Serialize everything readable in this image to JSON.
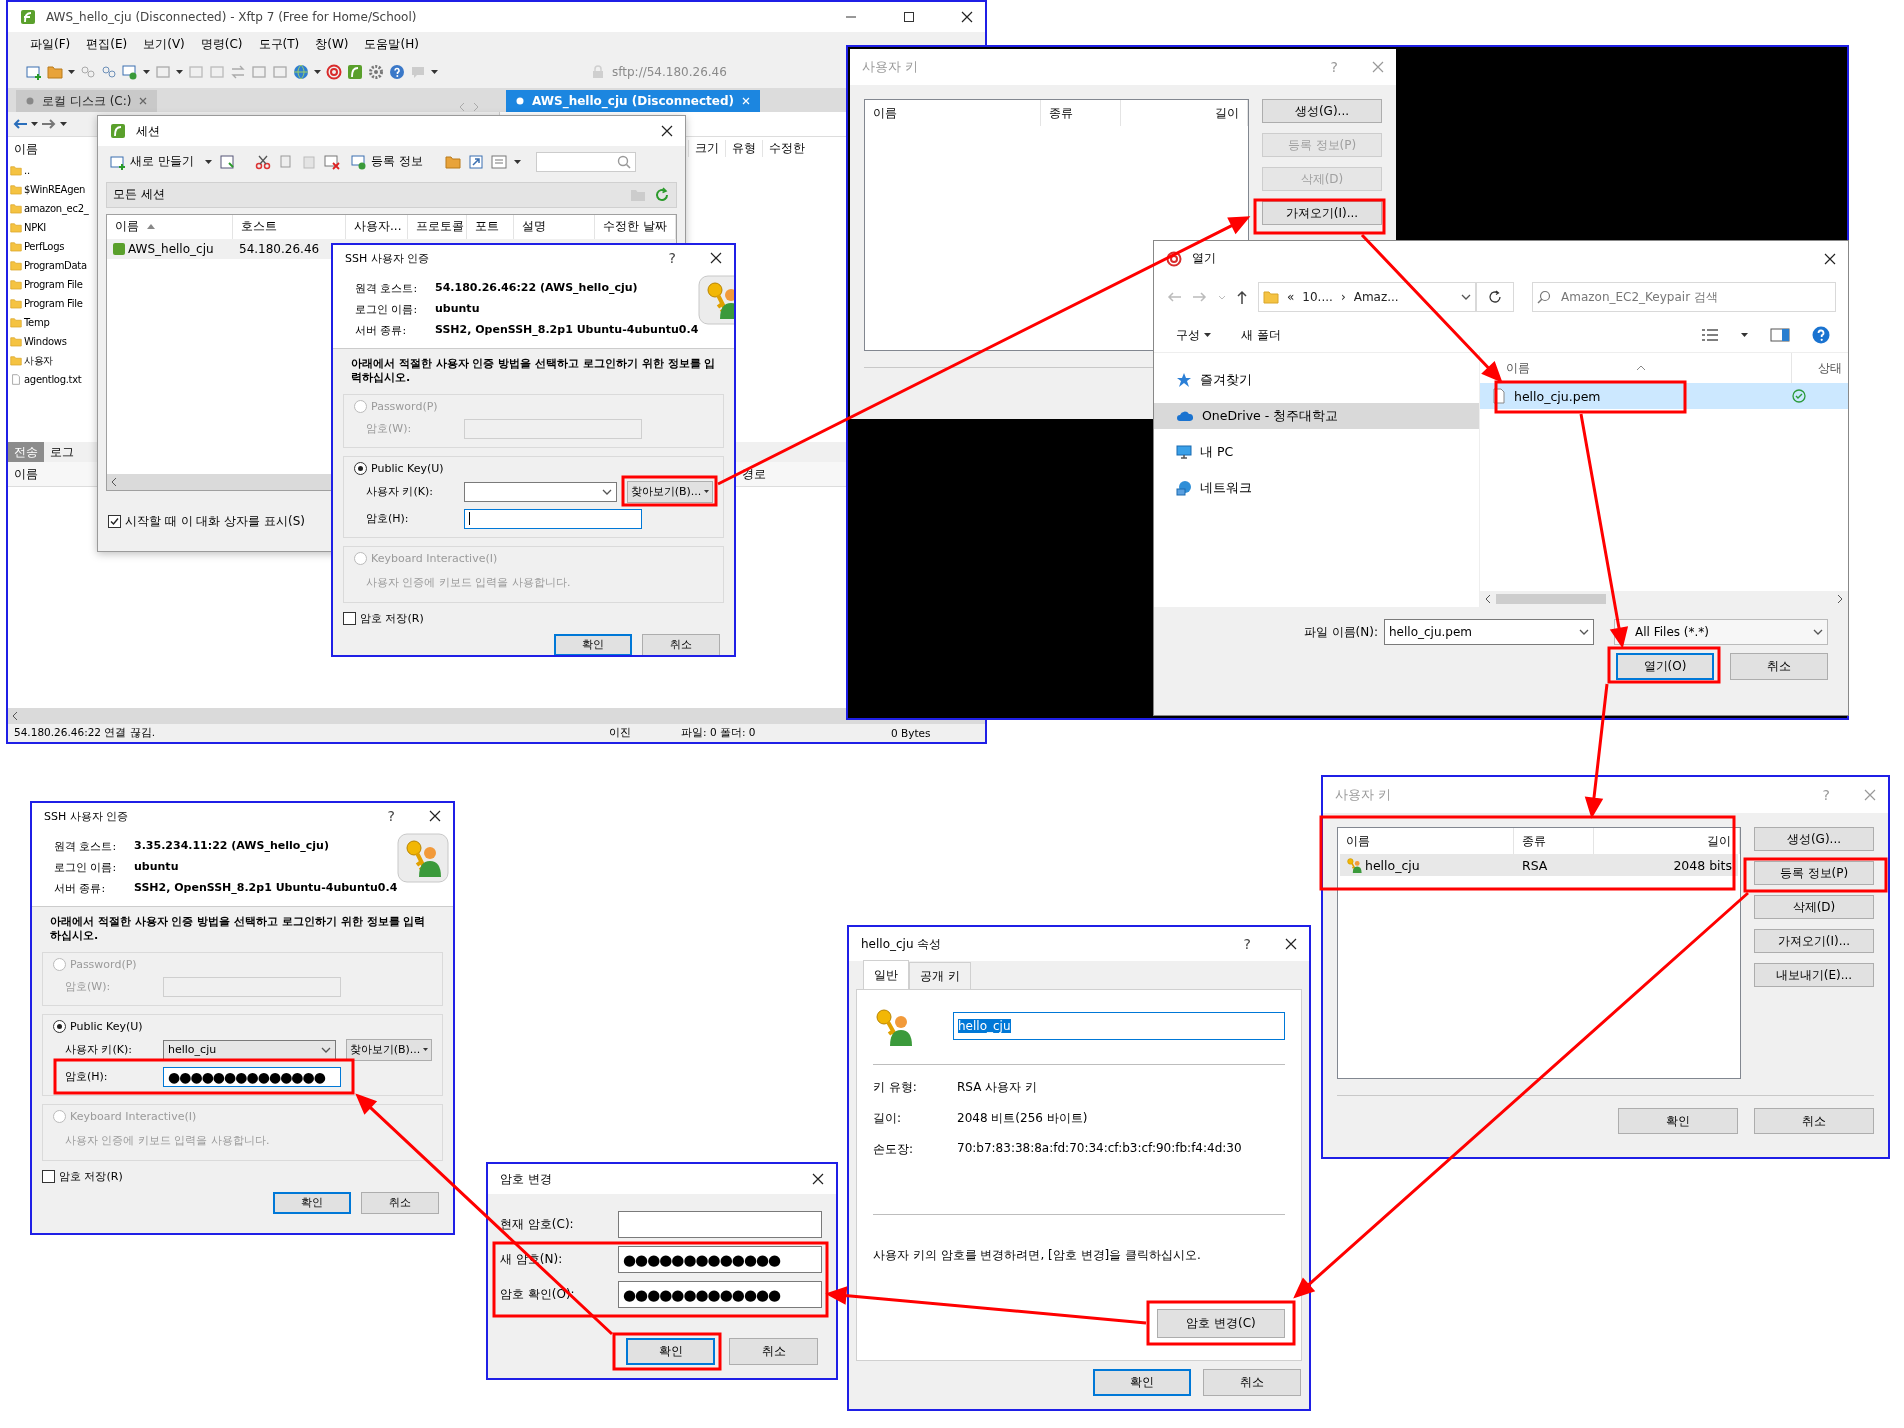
{
  "xftp_window": {
    "title": "AWS_hello_cju (Disconnected) - Xftp 7 (Free for Home/School)",
    "menu": [
      "파일(F)",
      "편집(E)",
      "보기(V)",
      "명령(C)",
      "도구(T)",
      "창(W)",
      "도움말(H)"
    ],
    "address": "sftp://54.180.26.46",
    "tabs": [
      {
        "label": "로컬 디스크 (C:)",
        "selected": false
      },
      {
        "label": "AWS_hello_cju (Disconnected)",
        "selected": true
      }
    ],
    "local_pane": {
      "column": "이름",
      "files": [
        {
          "name": "..",
          "kind": "folder"
        },
        {
          "name": "$WinREAgen",
          "kind": "folder"
        },
        {
          "name": "amazon_ec2_",
          "kind": "folder"
        },
        {
          "name": "NPKI",
          "kind": "folder"
        },
        {
          "name": "PerfLogs",
          "kind": "folder"
        },
        {
          "name": "ProgramData",
          "kind": "folder"
        },
        {
          "name": "Program File",
          "kind": "folder"
        },
        {
          "name": "Program File",
          "kind": "folder"
        },
        {
          "name": "Temp",
          "kind": "folder"
        },
        {
          "name": "Windows",
          "kind": "folder"
        },
        {
          "name": "사용자",
          "kind": "folder"
        },
        {
          "name": "agentlog.txt",
          "kind": "file"
        }
      ]
    },
    "remote_pane": {
      "columns": [
        "크기",
        "유형",
        "수정한"
      ]
    },
    "bottom_tabs": [
      {
        "label": "전송",
        "selected": true
      },
      {
        "label": "로그",
        "selected": false
      }
    ],
    "bottom_columns": [
      "이름",
      "경로"
    ],
    "status_bar": {
      "connection": "54.180.26.46:22 연결 끊김.",
      "mode": "이진",
      "counts": "파일: 0 폴더: 0",
      "size": "0 Bytes"
    }
  },
  "session_dialog": {
    "title": "세션",
    "new_button": "새로 만들기",
    "properties_button": "등록 정보",
    "path": "모든 세션",
    "columns": [
      "이름",
      "호스트",
      "사용자...",
      "프로토콜",
      "포트",
      "설명",
      "수정한 날짜"
    ],
    "rows": [
      {
        "cells": [
          "AWS_hello_cju",
          "54.180.26.46"
        ]
      }
    ],
    "show_on_startup": {
      "label": "시작할 때 이 대화 상자를 표시(S)",
      "checked": true
    }
  },
  "ssh_auth_dialogs": [
    {
      "title": "SSH 사용자 인증",
      "help": "?",
      "info": [
        {
          "label": "원격 호스트:",
          "value": "54.180.26.46:22 (AWS_hello_cju)"
        },
        {
          "label": "로그인 이름:",
          "value": "ubuntu"
        },
        {
          "label": "서버 종류:",
          "value": "SSH2, OpenSSH_8.2p1 Ubuntu-4ubuntu0.4"
        }
      ],
      "instruction": "아래에서 적절한 사용자 인증 방법을 선택하고 로그인하기 위한 정보를 입력하십시오.",
      "methods": [
        {
          "kind": "password",
          "label": "Password(P)",
          "selected": false,
          "field_label": "암호(W):"
        },
        {
          "kind": "public_key",
          "label": "Public Key(U)",
          "selected": true,
          "key_label": "사용자 키(K):",
          "browse_button": "찾아보기(B)...",
          "password_label": "암호(H):"
        },
        {
          "kind": "keyboard",
          "label": "Keyboard Interactive(I)",
          "selected": false,
          "hint": "사용자 인증에 키보드 입력을 사용합니다."
        }
      ],
      "save_password": {
        "label": "암호 저장(R)",
        "checked": false
      },
      "buttons": [
        "확인",
        "취소"
      ]
    },
    {
      "title": "SSH 사용자 인증",
      "help": "?",
      "info": [
        {
          "label": "원격 호스트:",
          "value": "3.35.234.11:22 (AWS_hello_cju)"
        },
        {
          "label": "로그인 이름:",
          "value": "ubuntu"
        },
        {
          "label": "서버 종류:",
          "value": "SSH2, OpenSSH_8.2p1 Ubuntu-4ubuntu0.4"
        }
      ],
      "instruction": "아래에서 적절한 사용자 인증 방법을 선택하고 로그인하기 위한 정보를 입력하십시오.",
      "methods": [
        {
          "kind": "password",
          "label": "Password(P)",
          "selected": false,
          "field_label": "암호(W):"
        },
        {
          "kind": "public_key",
          "label": "Public Key(U)",
          "selected": true,
          "key_label": "사용자 키(K):",
          "key_value": "hello_cju",
          "browse_button": "찾아보기(B)...",
          "password_label": "암호(H):",
          "password_value": "●●●●●●●●●●●●●●"
        },
        {
          "kind": "keyboard",
          "label": "Keyboard Interactive(I)",
          "selected": false,
          "hint": "사용자 인증에 키보드 입력을 사용합니다."
        }
      ],
      "save_password": {
        "label": "암호 저장(R)",
        "checked": false
      },
      "buttons": [
        "확인",
        "취소"
      ]
    }
  ],
  "user_key_dialogs": [
    {
      "title": "사용자 키",
      "help": "?",
      "columns": [
        "이름",
        "종류",
        "길이"
      ],
      "buttons": [
        {
          "label": "생성(G)...",
          "disabled": false
        },
        {
          "label": "등록 정보(P)",
          "disabled": true
        },
        {
          "label": "삭제(D)",
          "disabled": true
        },
        {
          "label": "가져오기(I)...",
          "disabled": false
        }
      ]
    },
    {
      "title": "사용자 키",
      "help": "?",
      "columns": [
        "이름",
        "종류",
        "길이"
      ],
      "rows": [
        {
          "name": "hello_cju",
          "type": "RSA",
          "length": "2048 bits",
          "selected": true
        }
      ],
      "buttons": [
        {
          "label": "생성(G)...",
          "disabled": false
        },
        {
          "label": "등록 정보(P)",
          "disabled": false
        },
        {
          "label": "삭제(D)",
          "disabled": false
        },
        {
          "label": "가져오기(I)...",
          "disabled": false
        },
        {
          "label": "내보내기(E)...",
          "disabled": false
        }
      ],
      "footer_buttons": [
        "확인",
        "취소"
      ]
    }
  ],
  "open_dialog": {
    "title": "열기",
    "breadcrumb": [
      "«",
      "10....",
      "›",
      "Amaz..."
    ],
    "search_placeholder": "Amazon_EC2_Keypair 검색",
    "toolbar": [
      "구성",
      "새 폴더"
    ],
    "nav": [
      {
        "kind": "favorites",
        "label": "즐겨찾기",
        "selected": false
      },
      {
        "kind": "cloud",
        "label": "OneDrive - 청주대학교",
        "selected": true
      },
      {
        "kind": "pc",
        "label": "내 PC",
        "selected": false
      },
      {
        "kind": "network",
        "label": "네트워크",
        "selected": false
      }
    ],
    "columns": [
      "이름",
      "상태"
    ],
    "files": [
      {
        "name": "hello_cju.pem",
        "selected": true
      }
    ],
    "file_name_label": "파일 이름(N):",
    "file_name": "hello_cju.pem",
    "filter": "All Files (*.*)",
    "buttons": [
      "열기(O)",
      "취소"
    ]
  },
  "properties_dialog": {
    "title": "hello_cju 속성",
    "help": "?",
    "tabs": [
      {
        "label": "일반",
        "selected": true
      },
      {
        "label": "공개 키",
        "selected": false
      }
    ],
    "name": "hello_cju",
    "name_selected": true,
    "details": [
      {
        "label": "키 유형:",
        "value": "RSA 사용자 키"
      },
      {
        "label": "길이:",
        "value": "2048 비트(256 바이트)"
      },
      {
        "label": "손도장:",
        "value": "70:b7:83:38:8a:fd:70:34:cf:b3:cf:90:fb:f4:4d:30"
      }
    ],
    "note": "사용자 키의 암호를 변경하려면, [암호 변경]을 클릭하십시오.",
    "change_button": "암호 변경(C)",
    "buttons": [
      "확인",
      "취소"
    ]
  },
  "change_password_dialog": {
    "title": "암호 변경",
    "fields": [
      {
        "label": "현재 암호(C):"
      },
      {
        "label": "새 암호(N):",
        "value": "●●●●●●●●●●●●●"
      },
      {
        "label": "암호 확인(O):",
        "value": "●●●●●●●●●●●●●"
      }
    ],
    "buttons": [
      "확인",
      "취소"
    ]
  }
}
